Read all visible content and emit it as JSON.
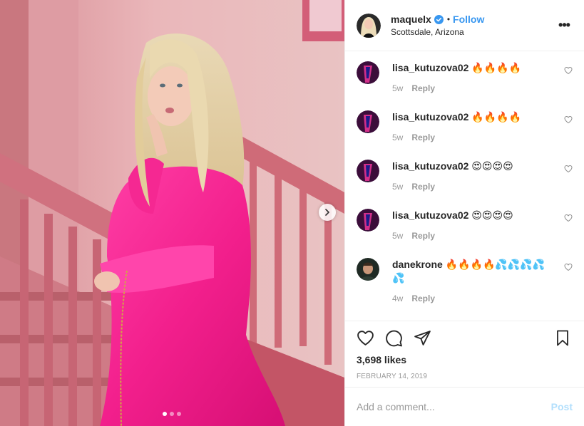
{
  "post": {
    "image_alt": "Woman in pink coat on a pink staircase",
    "carousel": {
      "current": 1,
      "total": 3
    },
    "next_icon": "chevron-right-icon"
  },
  "header": {
    "username": "maquelx",
    "verified": true,
    "separator": "•",
    "follow_label": "Follow",
    "location": "Scottsdale, Arizona",
    "more_label": "•••",
    "colors": {
      "follow": "#3897f0",
      "verified": "#3897f0"
    }
  },
  "comments": [
    {
      "user": "lisa_kutuzova02",
      "text": "🔥🔥🔥🔥",
      "age": "5w",
      "reply_label": "Reply"
    },
    {
      "user": "lisa_kutuzova02",
      "text": "🔥🔥🔥🔥",
      "age": "5w",
      "reply_label": "Reply"
    },
    {
      "user": "lisa_kutuzova02",
      "text": "😍😍😍😍",
      "age": "5w",
      "reply_label": "Reply"
    },
    {
      "user": "lisa_kutuzova02",
      "text": "😍😍😍😍",
      "age": "5w",
      "reply_label": "Reply"
    },
    {
      "user": "danekrone",
      "text": "🔥🔥🔥🔥💦💦💦💦💦",
      "age": "4w",
      "reply_label": "Reply"
    }
  ],
  "actions": {
    "icons": [
      "heart-icon",
      "comment-icon",
      "share-icon",
      "bookmark-icon"
    ],
    "likes": "3,698 likes",
    "date": "FEBRUARY 14, 2019"
  },
  "add_comment": {
    "placeholder": "Add a comment...",
    "post_label": "Post",
    "post_color": "#b2dffc"
  }
}
